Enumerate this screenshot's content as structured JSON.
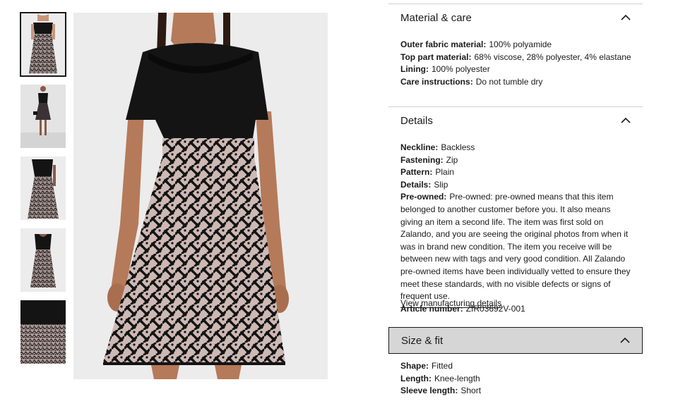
{
  "gallery": {
    "thumbnails": [
      {
        "label": "thumbnail-1",
        "selected": true
      },
      {
        "label": "thumbnail-2",
        "selected": false
      },
      {
        "label": "thumbnail-3",
        "selected": false
      },
      {
        "label": "thumbnail-4",
        "selected": false
      },
      {
        "label": "thumbnail-5",
        "selected": false
      }
    ]
  },
  "sections": {
    "material": {
      "title": "Material & care",
      "expanded": true,
      "attributes": [
        {
          "key": "Outer fabric material:",
          "value": "100% polyamide"
        },
        {
          "key": "Top part material:",
          "value": "68% viscose, 28% polyester, 4% elastane"
        },
        {
          "key": "Lining:",
          "value": "100% polyester"
        },
        {
          "key": "Care instructions:",
          "value": "Do not tumble dry"
        }
      ]
    },
    "details": {
      "title": "Details",
      "expanded": true,
      "attributes": [
        {
          "key": "Neckline:",
          "value": "Backless"
        },
        {
          "key": "Fastening:",
          "value": "Zip"
        },
        {
          "key": "Pattern:",
          "value": "Plain"
        },
        {
          "key": "Details:",
          "value": "Slip"
        },
        {
          "key": "Pre-owned:",
          "value": "Pre-owned: pre-owned means that this item belonged to another customer before you. It also means giving an item a second life. The item was first sold on Zalando, and you are seeing the original photos from when it was in brand new condition. The item you receive will be between new with tags and very good condition. All Zalando pre-owned items have been individually vetted to ensure they meet these standards, with no visible defects or signs of frequent use."
        },
        {
          "key": "Article number:",
          "value": "ZIR03692V-001"
        }
      ],
      "link_label": "View manufacturing details"
    },
    "size": {
      "title": "Size & fit",
      "expanded": true,
      "attributes": [
        {
          "key": "Shape:",
          "value": "Fitted"
        },
        {
          "key": "Length:",
          "value": "Knee-length"
        },
        {
          "key": "Sleeve length:",
          "value": "Short"
        }
      ]
    }
  },
  "colors": {
    "text": "#1a1a1a",
    "divider": "#d0d0d0",
    "active_header_bg": "#d6d6d6",
    "image_bg": "#ececec",
    "dress_black": "#141414",
    "lace_base": "#cdb9b4"
  },
  "icons": {
    "chevron": "chevron-up-icon"
  }
}
